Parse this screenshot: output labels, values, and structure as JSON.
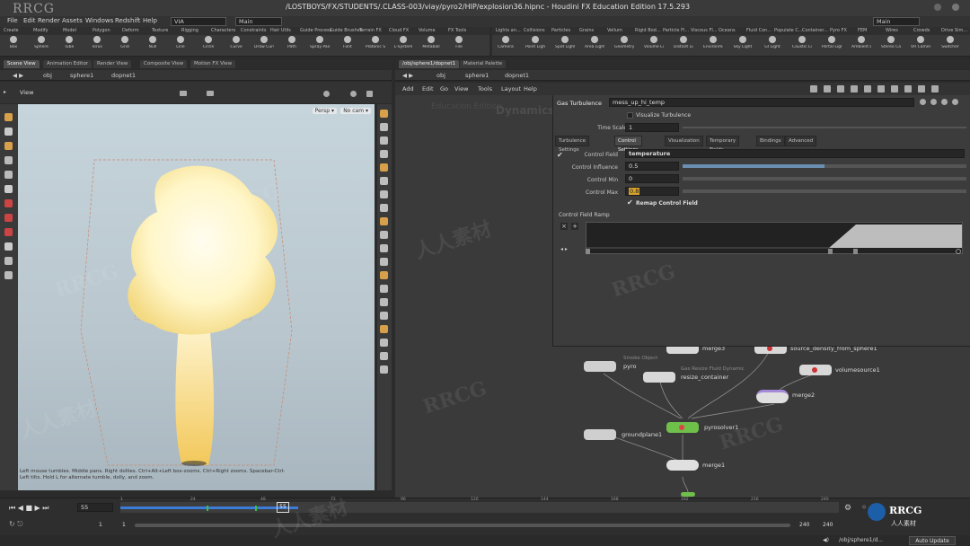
{
  "window": {
    "logo": "RRCG",
    "title": "/LOSTBOYS/FX/STUDENTS/.CLASS-003/viay/pyro2/HIP/explosion36.hipnc - Houdini FX Education Edition 17.5.293"
  },
  "menu": [
    "File",
    "Edit",
    "Render",
    "Assets",
    "Windows",
    "Redshift",
    "Help"
  ],
  "desktop_left": "VIA",
  "desktop_mid": "Main",
  "desktop_right": "Main",
  "shelf_tabs_left": [
    "Create",
    "Modify",
    "Model",
    "Polygon",
    "Deform",
    "Texture",
    "Rigging",
    "Characters",
    "Constraints",
    "Hair Utils",
    "Guide Process",
    "Guide Brushes",
    "Terrain FX",
    "Cloud FX",
    "Volume",
    "FX Tools"
  ],
  "shelf_tools_left": [
    "Box",
    "Sphere",
    "Tube",
    "Torus",
    "Grid",
    "Null",
    "Line",
    "Circle",
    "Curve",
    "Draw Curve",
    "Path",
    "Spray Paint",
    "Font",
    "Platonic Solids",
    "L-System",
    "Metaball",
    "File"
  ],
  "shelf_tabs_right": [
    "Lights an...",
    "Collisions",
    "Particles",
    "Grains",
    "Vellum",
    "Rigid Bod...",
    "Particle Fl...",
    "Viscous Fl...",
    "Oceans",
    "Fluid Con...",
    "Populate C...",
    "Container...",
    "Pyro FX",
    "FEM",
    "Wires",
    "Crowds",
    "Drive Sim..."
  ],
  "shelf_tools_right": [
    "Camera",
    "Point Light",
    "Spot Light",
    "Area Light",
    "Geometry Light",
    "Volume Light",
    "Distant Light",
    "Environment Light",
    "Sky Light",
    "GI Light",
    "Caustic Light",
    "Portal Light",
    "Ambient Light",
    "Stereo Camera",
    "VR Camera",
    "Switcher"
  ],
  "left_pane_tabs": [
    "Scene View",
    "Animation Editor",
    "Render View",
    "Composite View",
    "Motion FX View"
  ],
  "left_path": [
    "obj",
    "sphere1",
    "dopnet1"
  ],
  "view_label": "View",
  "persp_label": "Persp ▾",
  "cam_label": "No cam ▾",
  "viewport_help": "Left mouse tumbles. Middle pans. Right dollies. Ctrl+Alt+Left box-zooms. Ctrl+Right zooms. Spacebar-Ctrl-Left tilts. Hold L for alternate tumble, dolly, and zoom.",
  "right_pane_tabs": [
    "/obj/sphere1/dopnet1",
    "Material Palette"
  ],
  "right_path": [
    "obj",
    "sphere1",
    "dopnet1"
  ],
  "net_menu": [
    "Add",
    "Edit",
    "Go",
    "View",
    "Tools",
    "Layout",
    "Help"
  ],
  "net_watermark": "Education Edition",
  "net_context": "Dynamics",
  "params": {
    "node_type": "Gas Turbulence",
    "node_name": "mess_up_hi_temp",
    "visualize": "Visualize Turbulence",
    "timescale_label": "Time Scale",
    "timescale_value": "1",
    "tabs": [
      "Turbulence Settings",
      "Control Settings",
      "Visualization",
      "Temporary Fields",
      "Bindings",
      "Advanced"
    ],
    "control_field_label": "Control Field",
    "control_field_value": "temperature",
    "control_influence_label": "Control Influence",
    "control_influence_value": "0.5",
    "control_min_label": "Control Min",
    "control_min_value": "0",
    "control_max_label": "Control Max",
    "control_max_value": "0.8",
    "remap_label": "Remap Control Field",
    "ramp_label": "Control Field Ramp"
  },
  "nodes": {
    "merge3": "merge3",
    "source": "source_density_from_sphere1",
    "volumesource": "volumesource1",
    "smoke_sub": "Smoke Object",
    "pyro": "pyro",
    "resize_sub": "Gas Resize Fluid Dynamic",
    "resize": "resize_container",
    "merge2": "merge2",
    "pyrosolver": "pyrosolver1",
    "groundplane": "groundplane1",
    "merge1": "merge1"
  },
  "timeline": {
    "current_frame": "55",
    "marker": "55",
    "ticks": [
      "1",
      "24",
      "48",
      "72",
      "96",
      "120",
      "144",
      "168",
      "192",
      "216",
      "240"
    ],
    "start": "1",
    "start2": "1",
    "end": "240",
    "end2": "240"
  },
  "status": {
    "path": "/obj/sphere1/d...",
    "auto_update": "Auto Update"
  },
  "watermark_text": "RRCG",
  "watermark_cn": "人人素材",
  "colors": {
    "accent": "#6a8fb0",
    "pyrosolver": "#6fbf4b",
    "merge2": "#a58ad8",
    "warn": "#d6a12b"
  }
}
